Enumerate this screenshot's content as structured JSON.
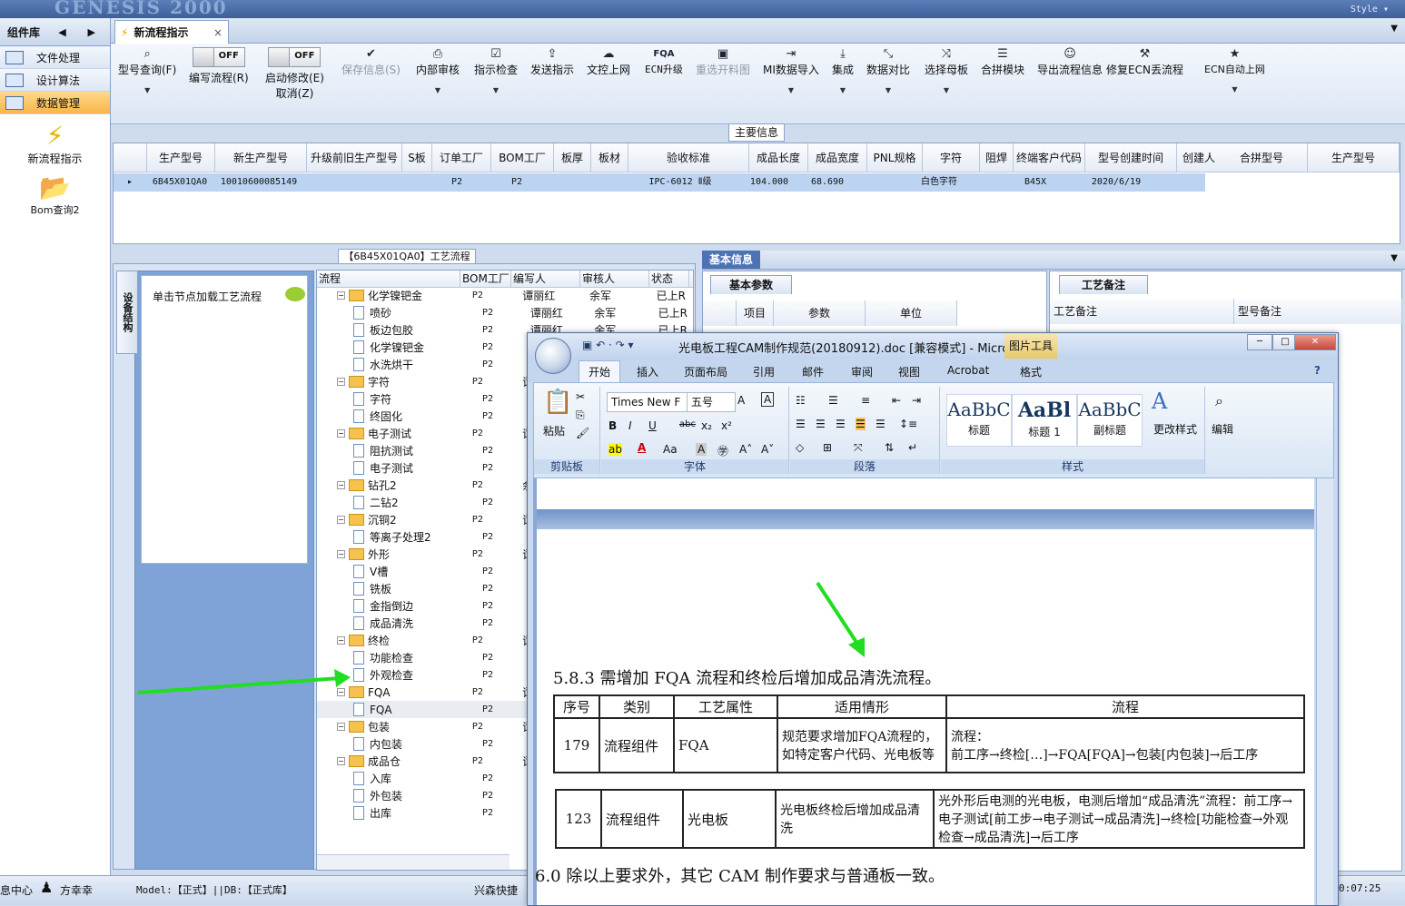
{
  "app": {
    "ghost_title": "GENESIS 2000",
    "style_label": "Style ▾"
  },
  "left_panel": {
    "title": "组件库",
    "nav": "◀ ▶",
    "items": [
      {
        "label": "文件处理"
      },
      {
        "label": "设计算法"
      },
      {
        "label": "数据管理"
      }
    ],
    "big_items": [
      {
        "label": "新流程指示"
      },
      {
        "label": "Bom查询2"
      }
    ]
  },
  "tabs": [
    {
      "label": "新流程指示",
      "close": "×"
    }
  ],
  "tab_dropdown": "▼",
  "toolbar": {
    "items": [
      {
        "label": "型号查询(F)",
        "icon": "search-icon",
        "glyph": "🔍"
      },
      {
        "label": "编写流程(R)",
        "toggle": "OFF"
      },
      {
        "label": "启动修改(E)",
        "label2": "取消(Z)",
        "toggle": "OFF"
      },
      {
        "label": "保存信息(S)",
        "icon": "check-icon",
        "glyph": "✔",
        "disabled": true
      },
      {
        "label": "内部审核",
        "icon": "print-icon",
        "glyph": "⎙"
      },
      {
        "label": "指示检查",
        "icon": "checkbox-icon",
        "glyph": "☑"
      },
      {
        "label": "发送指示",
        "icon": "upload-icon",
        "glyph": "⇪"
      },
      {
        "label": "文控上网",
        "icon": "cloud-upload-icon",
        "glyph": "☁"
      },
      {
        "label": "ECN升级",
        "icon": "fqa-icon",
        "glyph": "FQA"
      },
      {
        "label": "重选开料图",
        "icon": "image-icon",
        "glyph": "▣",
        "disabled": true
      },
      {
        "label": "MI数据导入",
        "icon": "import-icon",
        "glyph": "⇥"
      },
      {
        "label": "集成",
        "icon": "download-icon",
        "glyph": "⤓"
      },
      {
        "label": "数据对比",
        "icon": "compare-icon",
        "glyph": "⤡"
      },
      {
        "label": "选择母板",
        "icon": "shuffle-icon",
        "glyph": "⤨"
      },
      {
        "label": "合拼模块",
        "icon": "list-icon",
        "glyph": "☰"
      },
      {
        "label": "导出流程信息",
        "icon": "smiley-icon",
        "glyph": "☺"
      },
      {
        "label": "修复ECN丢流程",
        "icon": "wrench-icon",
        "glyph": "🔧"
      },
      {
        "label": "ECN自动上网",
        "icon": "star-icon",
        "glyph": "★"
      }
    ]
  },
  "main_info": {
    "title": "主要信息",
    "columns": [
      "生产型号",
      "新生产型号",
      "升级前旧生产型号",
      "S板",
      "订单工厂",
      "BOM工厂",
      "板厚",
      "板材",
      "验收标准",
      "成品长度",
      "成品宽度",
      "PNL规格",
      "字符",
      "阻焊",
      "终端客户代码",
      "型号创建时间",
      "创建人"
    ],
    "row": [
      "6B45X01QA0",
      "10010600085149",
      "",
      "",
      "P2",
      "P2",
      "",
      "",
      "IPC-6012 Ⅱ级",
      "104.000",
      "68.690",
      "",
      "白色字符",
      "",
      "B45X",
      "2020/6/19",
      ""
    ],
    "right_columns": [
      "合拼型号",
      "生产型号"
    ]
  },
  "process": {
    "title": "【6B45X01QA0】工艺流程",
    "side_tab": "设备结构",
    "hint": "单击节点加载工艺流程",
    "columns": [
      "流程",
      "BOM工厂",
      "编写人",
      "审核人",
      "状态"
    ],
    "rows": [
      {
        "name": "化学镍钯金",
        "folder": true,
        "f": "P2",
        "w": "谭丽红",
        "r": "余军",
        "s": "已上R"
      },
      {
        "name": "喷砂",
        "f": "P2",
        "w": "谭丽红",
        "r": "余军",
        "s": "已上R"
      },
      {
        "name": "板边包胶",
        "f": "P2",
        "w": "谭丽红",
        "r": "余军",
        "s": "已上R"
      },
      {
        "name": "化学镍钯金",
        "f": "P2",
        "w": "余",
        "r": "",
        "": ""
      },
      {
        "name": "水洗烘干",
        "f": "P2",
        "w": "谭",
        "r": "",
        "s": ""
      },
      {
        "name": "字符",
        "folder": true,
        "f": "P2",
        "w": "谭",
        "r": "",
        "s": ""
      },
      {
        "name": "字符",
        "f": "P2",
        "w": "谭",
        "r": "",
        "s": ""
      },
      {
        "name": "终固化",
        "f": "P2",
        "w": "谭",
        "r": "",
        "s": ""
      },
      {
        "name": "电子测试",
        "folder": true,
        "f": "P2",
        "w": "谭",
        "r": "",
        "s": ""
      },
      {
        "name": "阻抗测试",
        "f": "P2",
        "w": "谭",
        "r": "",
        "s": ""
      },
      {
        "name": "电子测试",
        "f": "P2",
        "w": "谭",
        "r": "",
        "s": ""
      },
      {
        "name": "钻孔2",
        "folder": true,
        "f": "P2",
        "w": "余",
        "r": "",
        "s": ""
      },
      {
        "name": "二钻2",
        "f": "P2",
        "w": "谭",
        "r": "",
        "s": ""
      },
      {
        "name": "沉铜2",
        "folder": true,
        "f": "P2",
        "w": "谭",
        "r": "",
        "s": ""
      },
      {
        "name": "等离子处理2",
        "f": "P2",
        "w": "谭",
        "r": "",
        "s": ""
      },
      {
        "name": "外形",
        "folder": true,
        "f": "P2",
        "w": "谭",
        "r": "",
        "s": ""
      },
      {
        "name": "V槽",
        "f": "P2",
        "w": "谭",
        "r": "",
        "s": ""
      },
      {
        "name": "铣板",
        "f": "P2",
        "w": "谭",
        "r": "",
        "s": ""
      },
      {
        "name": "金指倒边",
        "f": "P2",
        "w": "谭",
        "r": "",
        "s": ""
      },
      {
        "name": "成品清洗",
        "f": "P2",
        "w": "谭",
        "r": "",
        "s": ""
      },
      {
        "name": "终检",
        "folder": true,
        "f": "P2",
        "w": "谭",
        "r": "",
        "s": ""
      },
      {
        "name": "功能检查",
        "f": "P2",
        "w": "余",
        "r": "",
        "s": ""
      },
      {
        "name": "外观检查",
        "f": "P2",
        "w": "谭",
        "r": "",
        "s": ""
      },
      {
        "name": "FQA",
        "folder": true,
        "f": "P2",
        "w": "谭",
        "r": "",
        "s": ""
      },
      {
        "name": "FQA",
        "f": "P2",
        "w": "谭",
        "r": "",
        "s": ""
      },
      {
        "name": "包装",
        "folder": true,
        "f": "P2",
        "w": "谭",
        "r": "",
        "s": ""
      },
      {
        "name": "内包装",
        "f": "P2",
        "w": "谭",
        "r": "",
        "s": ""
      },
      {
        "name": "成品仓",
        "folder": true,
        "f": "P2",
        "w": "谭",
        "r": "",
        "s": ""
      },
      {
        "name": "入库",
        "f": "P2",
        "w": "谭",
        "r": "",
        "s": ""
      },
      {
        "name": "外包装",
        "f": "P2",
        "w": "谭",
        "r": "",
        "s": ""
      },
      {
        "name": "出库",
        "f": "P2",
        "w": "谭",
        "r": "",
        "s": ""
      }
    ]
  },
  "basic": {
    "tab": "基本信息",
    "param_tab": "基本参数",
    "param_cols": [
      "项目",
      "参数",
      "单位"
    ],
    "notes_tab": "工艺备注",
    "notes_cols": [
      "工艺备注",
      "型号备注"
    ]
  },
  "statusbar": {
    "left": "息中心",
    "user": "方幸幸",
    "model": "Model:【正式】||DB:【正式库】",
    "company": "兴森快捷",
    "time": "0:07:25"
  },
  "word": {
    "title": "光电板工程CAM制作规范(20180912).doc [兼容模式] - Micro...",
    "picture_tools": "图片工具",
    "tabs": [
      "开始",
      "插入",
      "页面布局",
      "引用",
      "邮件",
      "审阅",
      "视图",
      "Acrobat",
      "格式"
    ],
    "groups": {
      "clipboard": "剪贴板",
      "font": "字体",
      "paragraph": "段落",
      "styles": "样式"
    },
    "paste": "粘贴",
    "font_name": "Times New F",
    "font_size": "五号",
    "styles": [
      {
        "sample": "AaBbC",
        "name": "标题"
      },
      {
        "sample": "AaBl",
        "name": "标题 1"
      },
      {
        "sample": "AaBbC",
        "name": "副标题"
      }
    ],
    "change_styles": "更改样式",
    "edit": "编辑",
    "heading": "5.8.3 需增加 FQA 流程和终检后增加成品清洗流程。",
    "table_headers": [
      "序号",
      "类别",
      "工艺属性",
      "适用情形",
      "流程"
    ],
    "row1": [
      "179",
      "流程组件",
      "FQA",
      "规范要求增加FQA流程的，如特定客户代码、光电板等",
      "流程：\n前工序→终检[…]→FQA[FQA]→包装[内包装]→后工序"
    ],
    "row2": [
      "123",
      "流程组件",
      "光电板",
      "光电板终检后增加成品清洗",
      "光外形后电测的光电板，电测后增加“成品清洗”流程：前工序→电子测试[前工步→电子测试→成品清洗]→终检[功能检查→外观检查→成品清洗]→后工序"
    ],
    "footer_para": "6.0  除以上要求外，其它 CAM 制作要求与普通板一致。"
  }
}
